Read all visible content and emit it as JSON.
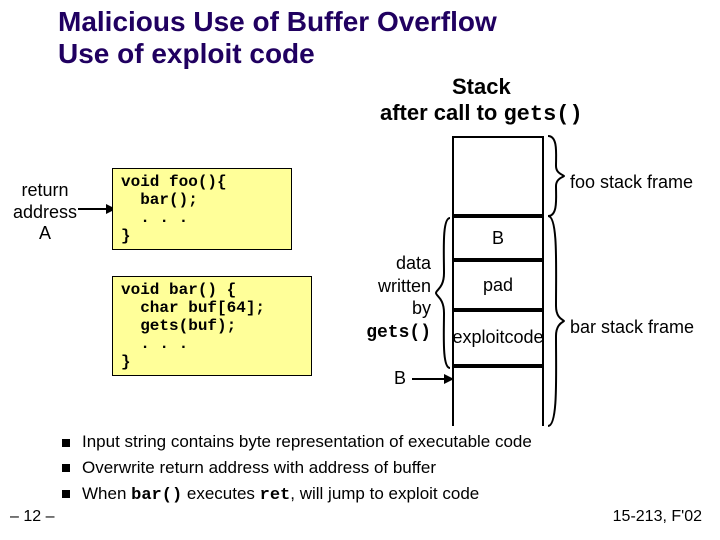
{
  "title_line1": "Malicious Use of Buffer Overflow",
  "title_line2": "Use of exploit code",
  "stack_heading_pre": "Stack",
  "stack_heading_line2a": "after call to ",
  "stack_heading_code": "gets()",
  "return_addr": {
    "line1": "return",
    "line2": "address",
    "line3": "A"
  },
  "code_foo": "void foo(){\n  bar();\n  . . .\n}",
  "code_bar": "void bar() {\n  char buf[64];\n  gets(buf);\n  . . .\n}",
  "data_written": {
    "l1": "data",
    "l2": "written",
    "l3": "by",
    "code": "gets()"
  },
  "b_ptr_label": "B",
  "cells": {
    "b": "B",
    "pad": "pad",
    "exploit_l1": "exploit",
    "exploit_l2": "code"
  },
  "foo_frame": "foo stack frame",
  "bar_frame": "bar stack frame",
  "bullets": {
    "b1": "Input string contains byte representation of executable code",
    "b2": "Overwrite return address with address of buffer",
    "b3_pre": "When ",
    "b3_code1": "bar()",
    "b3_mid": " executes ",
    "b3_code2": "ret",
    "b3_post": ", will jump to exploit code"
  },
  "slidenum": "– 12 –",
  "course": "15-213, F'02"
}
